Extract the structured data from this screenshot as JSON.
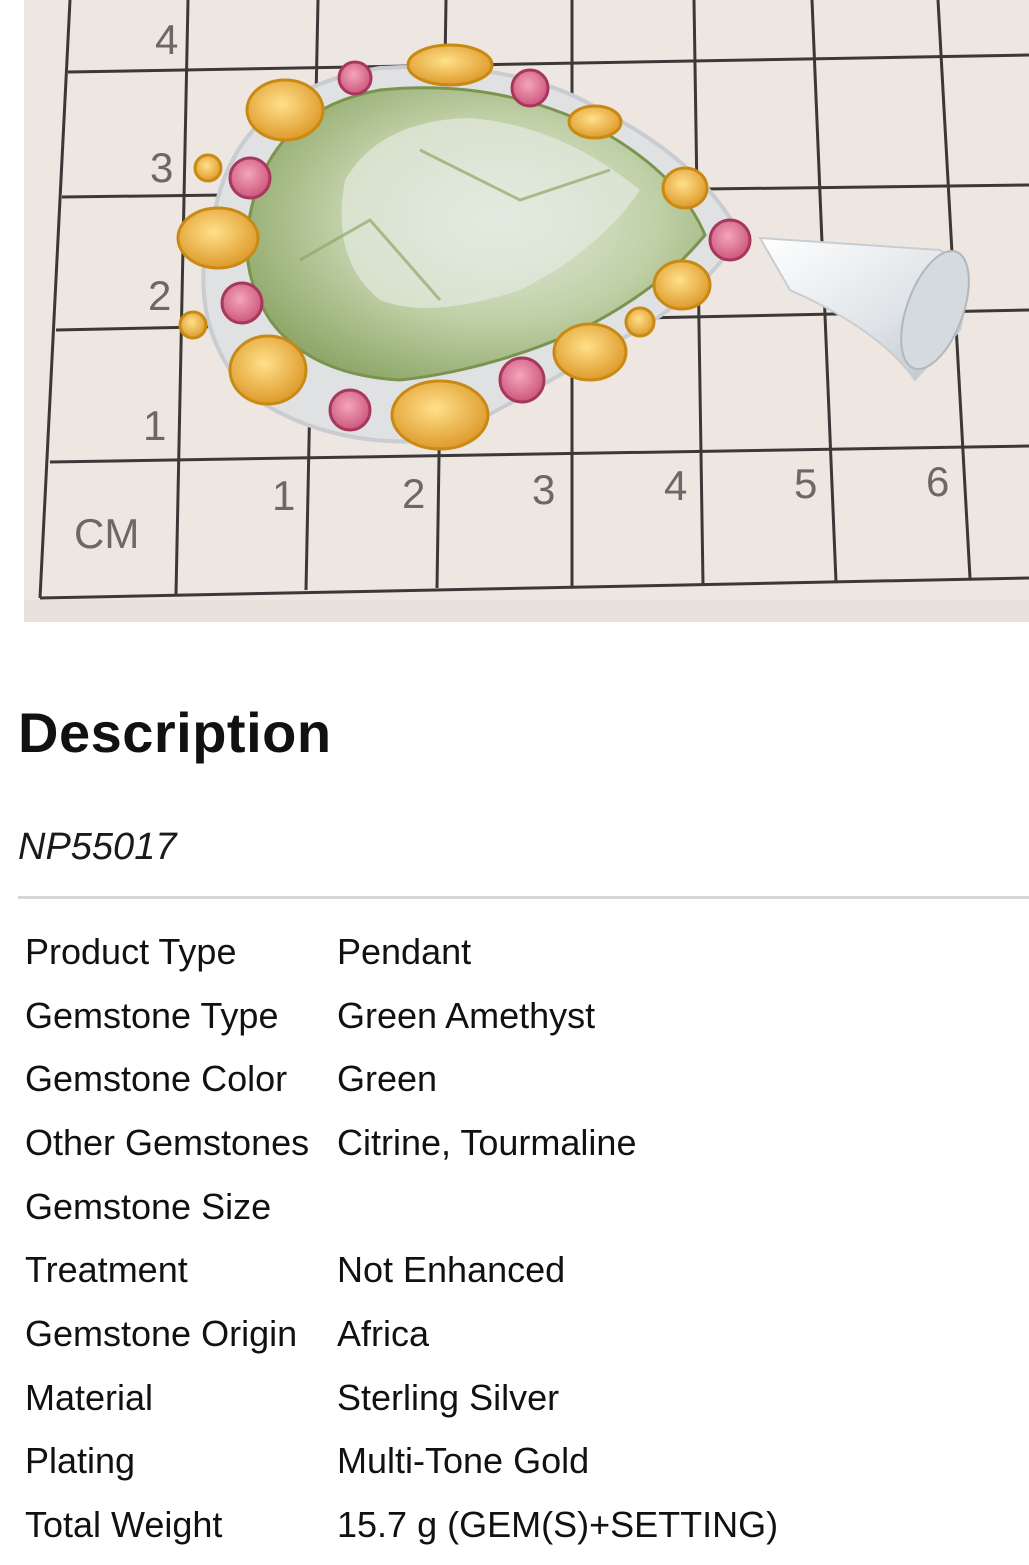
{
  "product_image": {
    "alt_subject": "pendant-photo",
    "ruler_unit": "CM",
    "x_ticks": [
      "1",
      "2",
      "3",
      "4",
      "5",
      "6"
    ],
    "y_ticks": [
      "4",
      "3",
      "2",
      "1"
    ]
  },
  "description": {
    "title": "Description",
    "sku": "NP55017"
  },
  "specs": [
    {
      "label": "Product Type",
      "value": "Pendant"
    },
    {
      "label": "Gemstone Type",
      "value": "Green Amethyst"
    },
    {
      "label": "Gemstone Color",
      "value": "Green"
    },
    {
      "label": "Other Gemstones",
      "value": "Citrine, Tourmaline"
    },
    {
      "label": "Gemstone Size",
      "value": ""
    },
    {
      "label": "Treatment",
      "value": "Not Enhanced"
    },
    {
      "label": "Gemstone Origin",
      "value": "Africa"
    },
    {
      "label": "Material",
      "value": "Sterling Silver"
    },
    {
      "label": "Plating",
      "value": "Multi-Tone Gold"
    },
    {
      "label": "Total Weight",
      "value": "15.7 g (GEM(S)+SETTING)"
    }
  ],
  "colors": {
    "grid_paper": "#ede6e1",
    "grid_line": "#3c3838",
    "main_stone": "#b7c99a",
    "citrine": "#e7ad3a",
    "tourmaline": "#d8688a",
    "silver": "#e9ecef"
  }
}
